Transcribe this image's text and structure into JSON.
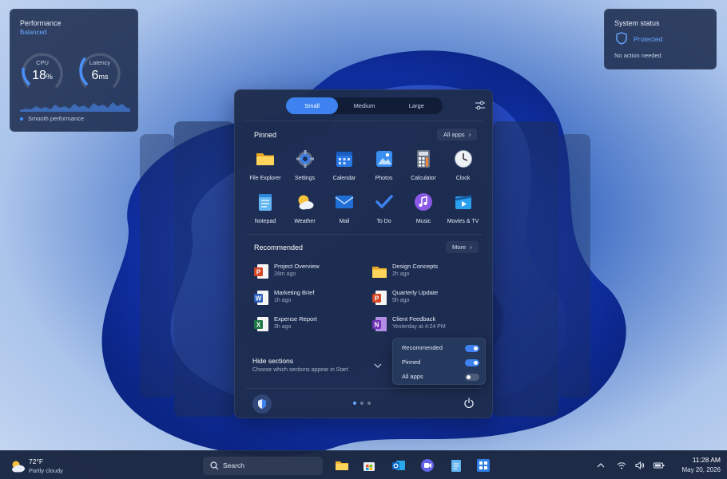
{
  "performance": {
    "title": "Performance",
    "mode": "Balanced",
    "cpu": {
      "label": "CPU",
      "value": "18",
      "unit": "%",
      "fraction": 0.18
    },
    "latency": {
      "label": "Latency",
      "value": "6",
      "unit": "ms",
      "fraction": 0.3
    },
    "status": "Smooth performance"
  },
  "system_status": {
    "title": "System status",
    "state": "Protected",
    "detail": "No action needed"
  },
  "start": {
    "sizes": [
      "Small",
      "Medium",
      "Large"
    ],
    "selected_size": "Small",
    "pinned": {
      "title": "Pinned",
      "all_apps_label": "All apps",
      "apps": [
        {
          "label": "File Explorer",
          "icon": "folder-icon"
        },
        {
          "label": "Settings",
          "icon": "gear-icon"
        },
        {
          "label": "Calendar",
          "icon": "calendar-icon"
        },
        {
          "label": "Photos",
          "icon": "photos-icon"
        },
        {
          "label": "Calculator",
          "icon": "calculator-icon"
        },
        {
          "label": "Clock",
          "icon": "clock-icon"
        },
        {
          "label": "Notepad",
          "icon": "notepad-icon"
        },
        {
          "label": "Weather",
          "icon": "weather-icon"
        },
        {
          "label": "Mail",
          "icon": "mail-icon"
        },
        {
          "label": "To Do",
          "icon": "checkmark-icon"
        },
        {
          "label": "Music",
          "icon": "music-icon"
        },
        {
          "label": "Movies & TV",
          "icon": "movies-icon"
        }
      ]
    },
    "recommended": {
      "title": "Recommended",
      "more_label": "More",
      "items": [
        {
          "name": "Project Overview",
          "time": "28m ago",
          "icon": "powerpoint-icon"
        },
        {
          "name": "Design Concepts",
          "time": "2h ago",
          "icon": "folder-icon"
        },
        {
          "name": "Marketing Brief",
          "time": "1h ago",
          "icon": "word-icon"
        },
        {
          "name": "Quarterly Update",
          "time": "5h ago",
          "icon": "powerpoint-icon"
        },
        {
          "name": "Expense Report",
          "time": "3h ago",
          "icon": "excel-icon"
        },
        {
          "name": "Client Feedback",
          "time": "Yesterday at 4:24 PM",
          "icon": "onenote-icon"
        }
      ]
    },
    "hide_sections": {
      "title": "Hide sections",
      "subtitle": "Choose which sections appear in Start"
    },
    "toggles": [
      {
        "label": "Recommended",
        "on": true
      },
      {
        "label": "Pinned",
        "on": true
      },
      {
        "label": "All apps",
        "on": false
      }
    ],
    "page_dots": 3,
    "active_dot": 0
  },
  "taskbar": {
    "weather_temp": "72°F",
    "weather_desc": "Partly cloudy",
    "search_placeholder": "Search",
    "time": "11:28 AM",
    "date": "May 20, 2026"
  },
  "colors": {
    "accent": "#3d82f0",
    "panel": "#1e2d4e",
    "link": "#6aa7ff"
  }
}
